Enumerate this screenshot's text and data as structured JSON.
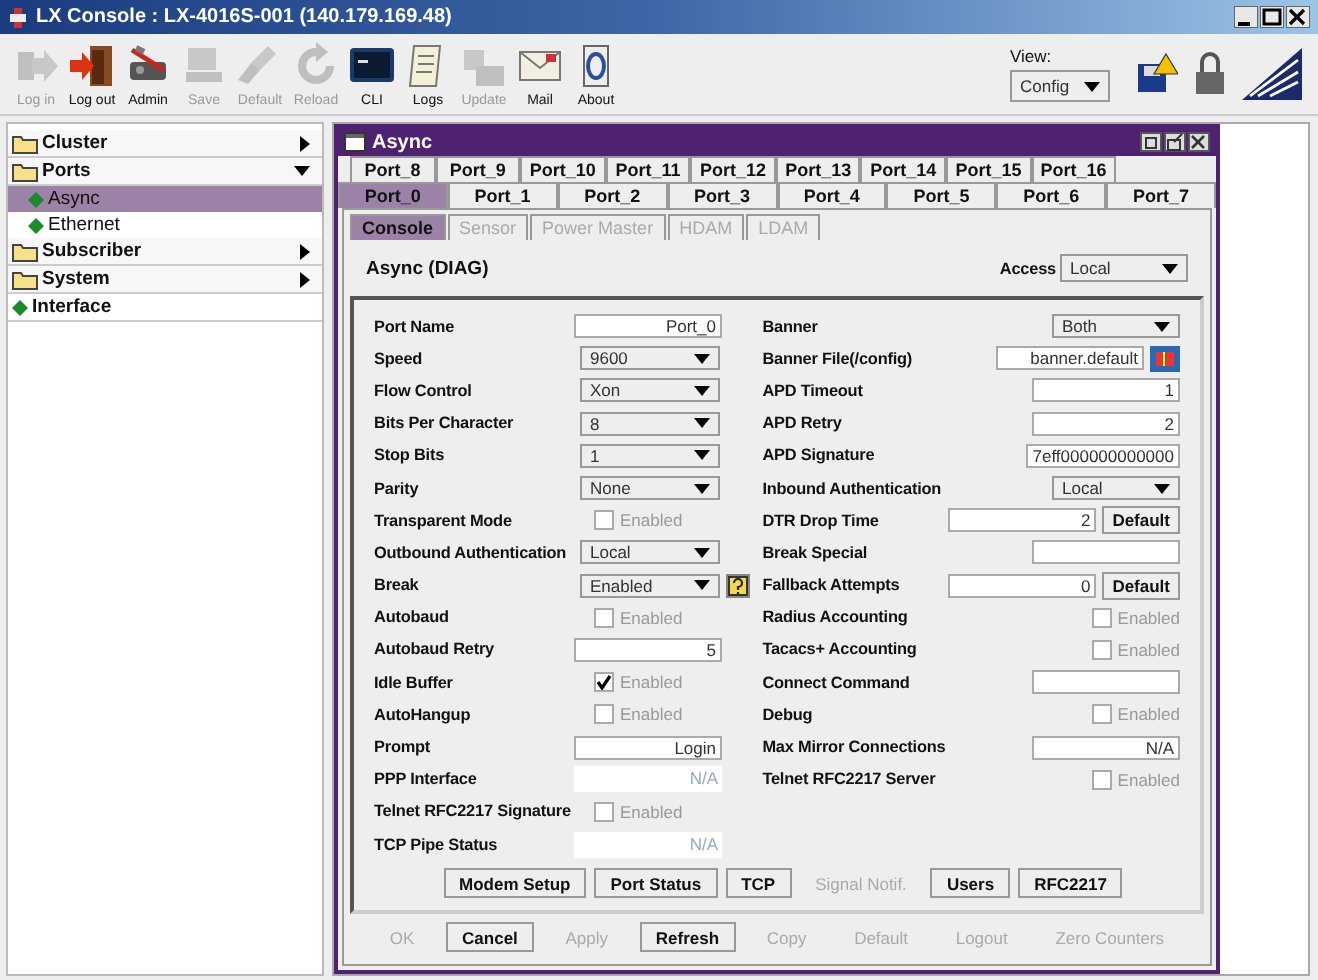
{
  "window": {
    "title": "LX Console : LX-4016S-001 (140.179.169.48)"
  },
  "toolbar": [
    {
      "label": "Log in",
      "disabled": true
    },
    {
      "label": "Log out",
      "disabled": false
    },
    {
      "label": "Admin",
      "disabled": false
    },
    {
      "label": "Save",
      "disabled": true
    },
    {
      "label": "Default",
      "disabled": true
    },
    {
      "label": "Reload",
      "disabled": true
    },
    {
      "label": "CLI",
      "disabled": false
    },
    {
      "label": "Logs",
      "disabled": false
    },
    {
      "label": "Update",
      "disabled": true
    },
    {
      "label": "Mail",
      "disabled": false
    },
    {
      "label": "About",
      "disabled": false
    }
  ],
  "view": {
    "label": "View:",
    "value": "Config"
  },
  "sidebar": [
    {
      "label": "Cluster",
      "kind": "folder",
      "expanded": false,
      "selected": false
    },
    {
      "label": "Ports",
      "kind": "folder",
      "expanded": true,
      "selected": false,
      "children": [
        {
          "label": "Async",
          "kind": "leaf",
          "selected": true
        },
        {
          "label": "Ethernet",
          "kind": "leaf",
          "selected": false
        }
      ]
    },
    {
      "label": "Subscriber",
      "kind": "folder",
      "expanded": false,
      "selected": false
    },
    {
      "label": "System",
      "kind": "folder",
      "expanded": false,
      "selected": false
    },
    {
      "label": "Interface",
      "kind": "leaf",
      "selected": false
    }
  ],
  "frame": {
    "title": "Async",
    "port_tabs_back": [
      {
        "label": "Port_8",
        "selected": false
      },
      {
        "label": "Port_9",
        "selected": false
      },
      {
        "label": "Port_10",
        "selected": false
      },
      {
        "label": "Port_11",
        "selected": false
      },
      {
        "label": "Port_12",
        "selected": false
      },
      {
        "label": "Port_13",
        "selected": false
      },
      {
        "label": "Port_14",
        "selected": false
      },
      {
        "label": "Port_15",
        "selected": false
      },
      {
        "label": "Port_16",
        "selected": false
      }
    ],
    "port_tabs_front": [
      {
        "label": "Port_0",
        "selected": true
      },
      {
        "label": "Port_1",
        "selected": false
      },
      {
        "label": "Port_2",
        "selected": false
      },
      {
        "label": "Port_3",
        "selected": false
      },
      {
        "label": "Port_4",
        "selected": false
      },
      {
        "label": "Port_5",
        "selected": false
      },
      {
        "label": "Port_6",
        "selected": false
      },
      {
        "label": "Port_7",
        "selected": false
      }
    ],
    "sub_tabs": [
      {
        "label": "Console",
        "selected": true,
        "disabled": false
      },
      {
        "label": "Sensor",
        "selected": false,
        "disabled": true
      },
      {
        "label": "Power Master",
        "selected": false,
        "disabled": true
      },
      {
        "label": "HDAM",
        "selected": false,
        "disabled": true
      },
      {
        "label": "LDAM",
        "selected": false,
        "disabled": true
      }
    ],
    "heading": "Async (DIAG)",
    "access": {
      "label": "Access",
      "value": "Local"
    },
    "left_fields": [
      {
        "label": "Port Name",
        "kind": "text",
        "value": "Port_0"
      },
      {
        "label": "Speed",
        "kind": "select",
        "value": "9600"
      },
      {
        "label": "Flow Control",
        "kind": "select",
        "value": "Xon"
      },
      {
        "label": "Bits Per Character",
        "kind": "select",
        "value": "8"
      },
      {
        "label": "Stop Bits",
        "kind": "select",
        "value": "1"
      },
      {
        "label": "Parity",
        "kind": "select",
        "value": "None"
      },
      {
        "label": "Transparent Mode",
        "kind": "checkbox",
        "value": "Enabled",
        "checked": false
      },
      {
        "label": "Outbound Authentication",
        "kind": "select",
        "value": "Local"
      },
      {
        "label": "Break",
        "kind": "select-help",
        "value": "Enabled"
      },
      {
        "label": "Autobaud",
        "kind": "checkbox",
        "value": "Enabled",
        "checked": false
      },
      {
        "label": "Autobaud Retry",
        "kind": "text",
        "value": "5"
      },
      {
        "label": "Idle Buffer",
        "kind": "checkbox",
        "value": "Enabled",
        "checked": true
      },
      {
        "label": "AutoHangup",
        "kind": "checkbox",
        "value": "Enabled",
        "checked": false
      },
      {
        "label": "Prompt",
        "kind": "text",
        "value": "Login"
      },
      {
        "label": "PPP Interface",
        "kind": "readonly",
        "value": "N/A"
      },
      {
        "label": "Telnet RFC2217 Signature",
        "kind": "checkbox",
        "value": "Enabled",
        "checked": false
      },
      {
        "label": "TCP Pipe Status",
        "kind": "readonly",
        "value": "N/A"
      }
    ],
    "right_fields": [
      {
        "label": "Banner",
        "kind": "select",
        "value": "Both"
      },
      {
        "label": "Banner File(/config)",
        "kind": "text-browse",
        "value": "banner.default"
      },
      {
        "label": "APD Timeout",
        "kind": "text",
        "value": "1"
      },
      {
        "label": "APD Retry",
        "kind": "text",
        "value": "2"
      },
      {
        "label": "APD Signature",
        "kind": "text",
        "value": "7eff000000000000"
      },
      {
        "label": "Inbound Authentication",
        "kind": "select",
        "value": "Local"
      },
      {
        "label": "DTR Drop Time",
        "kind": "text",
        "value": "2",
        "button": "Default"
      },
      {
        "label": "Break Special",
        "kind": "text"
      },
      {
        "label": "Fallback Attempts",
        "kind": "text",
        "value": "0",
        "button": "Default"
      },
      {
        "label": "Radius Accounting",
        "kind": "checkbox",
        "value": "Enabled",
        "checked": false
      },
      {
        "label": "Tacacs+ Accounting",
        "kind": "checkbox",
        "value": "Enabled",
        "checked": false
      },
      {
        "label": "Connect Command",
        "kind": "text"
      },
      {
        "label": "Debug",
        "kind": "checkbox",
        "value": "Enabled",
        "checked": false
      },
      {
        "label": "Max Mirror Connections",
        "kind": "text",
        "value": "N/A"
      },
      {
        "label": "Telnet RFC2217 Server",
        "kind": "checkbox",
        "value": "Enabled",
        "checked": false
      }
    ],
    "action_buttons": [
      {
        "label": "Modem Setup",
        "disabled": false
      },
      {
        "label": "Port Status",
        "disabled": false
      },
      {
        "label": "TCP",
        "disabled": false
      },
      {
        "label": "Signal Notif.",
        "disabled": true
      },
      {
        "label": "Users",
        "disabled": false
      },
      {
        "label": "RFC2217",
        "disabled": false
      }
    ],
    "footer_buttons": [
      {
        "label": "OK",
        "disabled": true
      },
      {
        "label": "Cancel",
        "disabled": false
      },
      {
        "label": "Apply",
        "disabled": true
      },
      {
        "label": "Refresh",
        "disabled": false
      },
      {
        "label": "Copy",
        "disabled": true
      },
      {
        "label": "Default",
        "disabled": true
      },
      {
        "label": "Logout",
        "disabled": true
      },
      {
        "label": "Zero Counters",
        "disabled": true
      }
    ]
  }
}
